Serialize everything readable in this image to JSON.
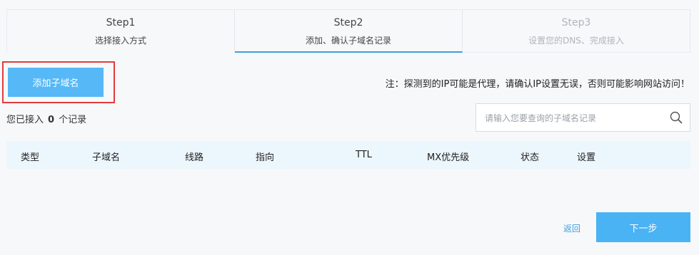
{
  "steps": [
    {
      "num": "Step1",
      "label": "选择接入方式",
      "state": "done"
    },
    {
      "num": "Step2",
      "label": "添加、确认子域名记录",
      "state": "active"
    },
    {
      "num": "Step3",
      "label": "设置您的DNS、完成接入",
      "state": "disabled"
    }
  ],
  "toolbar": {
    "add_subdomain_label": "添加子域名",
    "notice": "注：探测到的IP可能是代理，请确认IP设置无误，否则可能影响网站访问！"
  },
  "summary": {
    "prefix": "您已接入",
    "count": "0",
    "suffix": "个记录"
  },
  "search": {
    "placeholder": "请输入您要查询的子域名记录",
    "icon": "search-icon"
  },
  "table": {
    "headers": [
      "类型",
      "子域名",
      "线路",
      "指向",
      "TTL",
      "MX优先级",
      "状态",
      "设置"
    ]
  },
  "footer": {
    "back_label": "返回",
    "next_label": "下一步"
  },
  "colors": {
    "accent": "#3a9fdf",
    "button": "#56b8f6",
    "highlight_border": "#e23b3b",
    "table_header_bg": "#ecf6fd"
  }
}
